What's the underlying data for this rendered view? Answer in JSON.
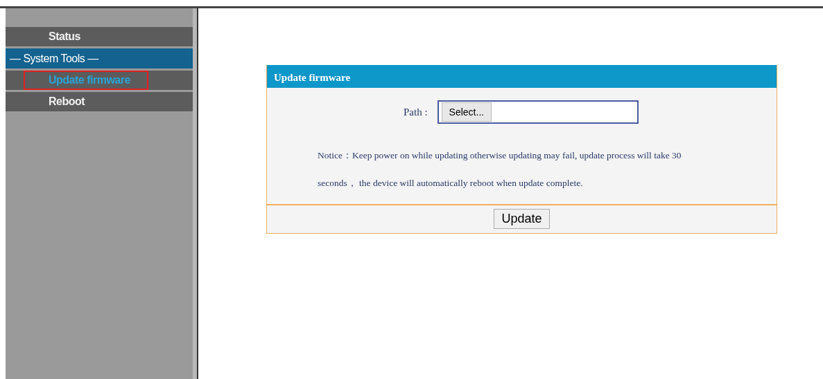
{
  "sidebar": {
    "items": [
      {
        "label": "Status",
        "kind": "item",
        "selected": false
      },
      {
        "label": "— System Tools —",
        "kind": "header"
      },
      {
        "label": "Update firmware",
        "kind": "item",
        "selected": true
      },
      {
        "label": "Reboot",
        "kind": "item",
        "selected": false
      }
    ]
  },
  "panel": {
    "title": "Update firmware",
    "path_label": "Path :",
    "file_button": "Select...",
    "notice": "Notice：Keep power on while updating otherwise updating may fail, update process will take 30 seconds， the device will automatically reboot when update complete.",
    "submit": "Update"
  }
}
